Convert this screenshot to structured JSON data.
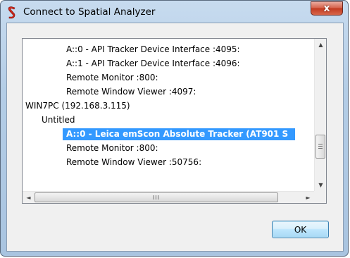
{
  "window": {
    "title": "Connect to Spatial Analyzer",
    "close_label": "x"
  },
  "tree": {
    "items": [
      {
        "label": "A::0 - API Tracker Device Interface  :4095:",
        "selected": false
      },
      {
        "label": "A::1 - API Tracker Device Interface  :4096:",
        "selected": false
      },
      {
        "label": "Remote Monitor  :800:",
        "selected": false
      },
      {
        "label": "Remote Window Viewer  :4097:",
        "selected": false
      },
      {
        "label": "WIN7PC (192.168.3.115)",
        "selected": false
      },
      {
        "label": "Untitled",
        "selected": false
      },
      {
        "label": "A::0 - Leica emScon Absolute Tracker (AT901 S",
        "selected": true
      },
      {
        "label": "Remote Monitor  :800:",
        "selected": false
      },
      {
        "label": "Remote Window Viewer  :50756:",
        "selected": false
      }
    ]
  },
  "scrollbar": {
    "up_glyph": "▲",
    "down_glyph": "▼",
    "left_glyph": "◄",
    "right_glyph": "►",
    "h_grip": "III"
  },
  "buttons": {
    "ok_label": "OK"
  },
  "colors": {
    "selection": "#3399ff",
    "close_button": "#c23a20",
    "ok_border": "#3c7fb1"
  }
}
